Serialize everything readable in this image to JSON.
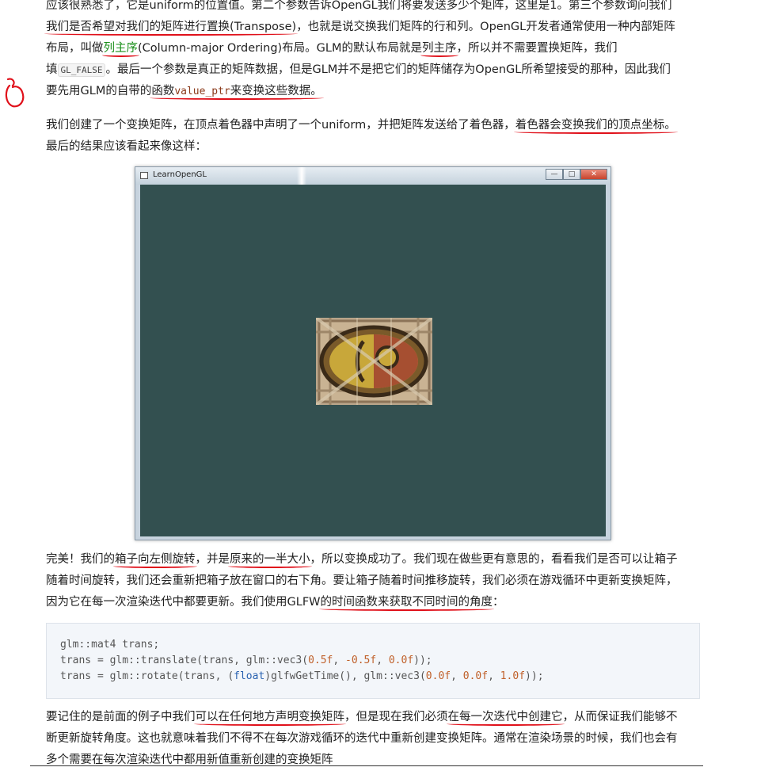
{
  "para1": {
    "l1": "应该很熟悉了，它是uniform的位置值。第二个参数告诉OpenGL我们将要发送多少个矩阵，这里是1。第三个参数询问我们",
    "l2a": "我们是否希望对我们的矩阵进行置换(Transpose)",
    "l2b": "，也就是说交换我们矩阵的行和列。OpenGL开发者通常使用一种内部矩阵",
    "l3a": "布局，叫做",
    "l3term": "列主序",
    "l3b": "(Column-major Ordering)布局。GLM的默认布局就是",
    "l3c": "列主序",
    "l3d": "，所以并不需要置换矩阵，我们",
    "l4a": "填",
    "l4code": "GL_FALSE",
    "l4b": "。最后一个参数是真正的矩阵数据，但是GLM并不是把它们的矩阵储存为OpenGL所希望接受的那种，因此我们",
    "l5a": "要先用GLM的自带的",
    "l5b": "函数",
    "l5code": "value_ptr",
    "l5c": "来变换这些数据。"
  },
  "para2": {
    "l1a": "我们创建了一个变换矩阵，在顶点着色器中声明了一个uniform，并把矩阵发送给了着色器，",
    "l1b": "着色器会变换我们的顶点坐标。",
    "l2": "最后的结果应该看起来像这样："
  },
  "window": {
    "title": "LearnOpenGL",
    "minimize": "—",
    "maximize": "□",
    "close": "✕"
  },
  "para3": {
    "l1a": "完美！我们的",
    "l1b": "箱子向左侧旋转",
    "l1c": "，并是",
    "l1d": "原来的一半大小",
    "l1e": "，所以变换成功了。我们现在做些更有意思的，看看我们是否可以让箱子",
    "l2": "随着时间旋转，我们还会重新把箱子放在窗口的右下角。要让箱子随着时间推移旋转，我们必须在游戏循环中更新变换矩阵，",
    "l3a": "因为它在每一次渲染迭代中都要更新。我们使用GLFW",
    "l3b": "的时间函数来获取不同时间的角度",
    "l3c": "："
  },
  "code": {
    "line1": "glm::mat4 trans;",
    "line2a": "trans = glm::translate(trans, glm::vec3(",
    "line2n1": "0.5f",
    "line2n2": "-0.5f",
    "line2n3": "0.0f",
    "line2end": "));",
    "line3a": "trans = glm::rotate(trans, (",
    "line3kw": "float",
    "line3b": ")glfwGetTime(), glm::vec3(",
    "line3n1": "0.0f",
    "line3n2": "0.0f",
    "line3n3": "1.0f",
    "line3end": "));",
    "sep": ", "
  },
  "para5": {
    "l1a": "要记住的是前面的例子中我们",
    "l1b": "可以在任何地方声明变换矩阵",
    "l1c": "，但是现在我们必须",
    "l1d": "在每一次迭代中创建它",
    "l1e": "，从而保证我们能够不",
    "l2": "断更新旋转角度。这也就意味着我们不得不在每次游戏循环的迭代中重新创建变换矩阵。通常在渲染场景的时候，我们也会有",
    "l3": "多个需要在每次渲染迭代中都用新值重新创建的变换矩阵"
  },
  "colors": {
    "annotation": "#e0101a",
    "canvas": "#335050",
    "term": "#1a8f1a"
  }
}
